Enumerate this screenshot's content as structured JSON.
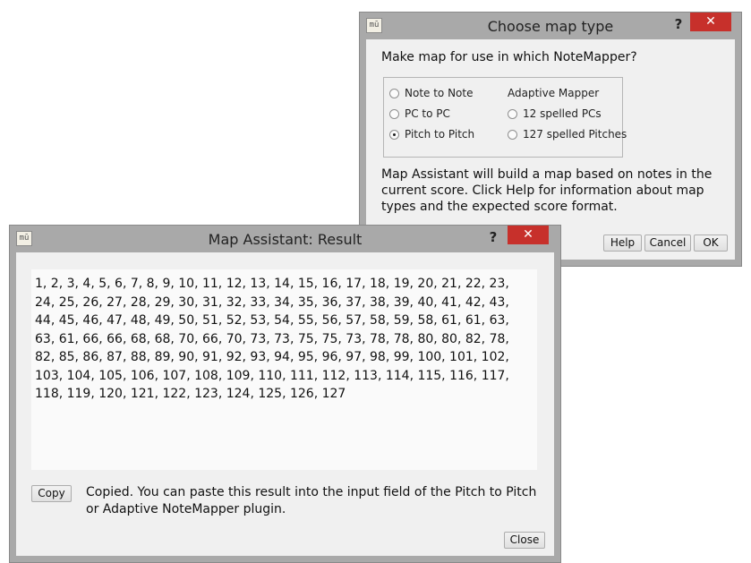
{
  "choose_dialog": {
    "title": "Choose map type",
    "help_glyph": "?",
    "close_glyph": "✕",
    "icon_text": "mū",
    "question": "Make map for use in which NoteMapper?",
    "group_header": "Adaptive Mapper",
    "options": [
      {
        "label": "Note to Note",
        "selected": false
      },
      {
        "label": "PC to PC",
        "selected": false
      },
      {
        "label": "Pitch to Pitch",
        "selected": true
      },
      {
        "label": "12 spelled PCs",
        "selected": false
      },
      {
        "label": "127 spelled Pitches",
        "selected": false
      }
    ],
    "description": "Map Assistant will build a map based on notes in the current score. Click Help for information about map types and the expected score format.",
    "buttons": {
      "help": "Help",
      "cancel": "Cancel",
      "ok": "OK"
    }
  },
  "result_dialog": {
    "title": "Map Assistant: Result",
    "help_glyph": "?",
    "close_glyph": "✕",
    "icon_text": "mū",
    "result_text": "1, 2, 3, 4, 5, 6, 7, 8, 9, 10, 11, 12, 13, 14, 15, 16, 17, 18, 19, 20, 21, 22, 23, 24, 25, 26, 27, 28, 29, 30, 31, 32, 33, 34, 35, 36, 37, 38, 39, 40, 41, 42, 43, 44, 45, 46, 47, 48, 49, 50, 51, 52, 53, 54, 55, 56, 57, 58, 59, 58, 61, 61, 63, 63, 61, 66, 66, 68, 68, 70, 66, 70, 73, 73, 75, 75, 73, 78, 78, 80, 80, 82, 78, 82, 85, 86, 87, 88, 89, 90, 91, 92, 93, 94, 95, 96, 97, 98, 99, 100, 101, 102, 103, 104, 105, 106, 107, 108, 109, 110, 111, 112, 113, 114, 115, 116, 117, 118, 119, 120, 121, 122, 123, 124, 125, 126, 127",
    "copy_label": "Copy",
    "status": "Copied. You can paste this result into the input field of the Pitch to Pitch or Adaptive NoteMapper plugin.",
    "close_label": "Close"
  }
}
